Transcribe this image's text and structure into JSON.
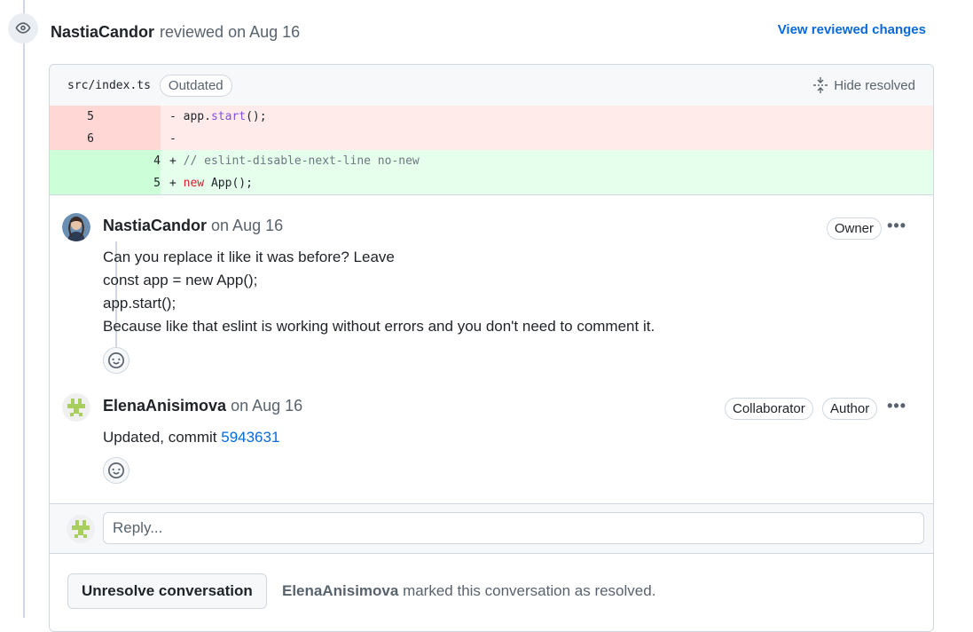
{
  "review": {
    "author": "NastiaCandor",
    "action": "reviewed on Aug 16",
    "view_changes_label": "View reviewed changes"
  },
  "file": {
    "path": "src/index.ts",
    "badge": "Outdated",
    "hide_resolved_label": "Hide resolved"
  },
  "diff": [
    {
      "type": "del",
      "old": "5",
      "new": "",
      "sign": "-",
      "code": [
        {
          "t": "app."
        },
        {
          "t": "start",
          "c": "fn"
        },
        {
          "t": "();"
        }
      ]
    },
    {
      "type": "del",
      "old": "6",
      "new": "",
      "sign": "-",
      "code": []
    },
    {
      "type": "add",
      "old": "",
      "new": "4",
      "sign": "+",
      "code": [
        {
          "t": "// eslint-disable-next-line no-new",
          "c": "cm"
        }
      ]
    },
    {
      "type": "add",
      "old": "",
      "new": "5",
      "sign": "+",
      "code": [
        {
          "t": "new",
          "c": "kw"
        },
        {
          "t": " App();"
        }
      ]
    }
  ],
  "comments": [
    {
      "author": "NastiaCandor",
      "date": "on Aug 16",
      "badges": [
        "Owner"
      ],
      "body_lines": [
        "Can you replace it like it was before? Leave",
        "const app = new App();",
        "app.start();",
        "Because like that eslint is working without errors and you don't need to comment it."
      ]
    },
    {
      "author": "ElenaAnisimova",
      "date": "on Aug 16",
      "badges": [
        "Collaborator",
        "Author"
      ],
      "body_prefix": "Updated, commit ",
      "commit_link": "5943631"
    }
  ],
  "kebab": "•••",
  "reply": {
    "placeholder": "Reply..."
  },
  "resolve": {
    "button_label": "Unresolve conversation",
    "by": "ElenaAnisimova",
    "text": "marked this conversation as resolved."
  },
  "colors": {
    "accent": "#0969da",
    "del_bg": "#ffebe9",
    "add_bg": "#e6ffec"
  }
}
